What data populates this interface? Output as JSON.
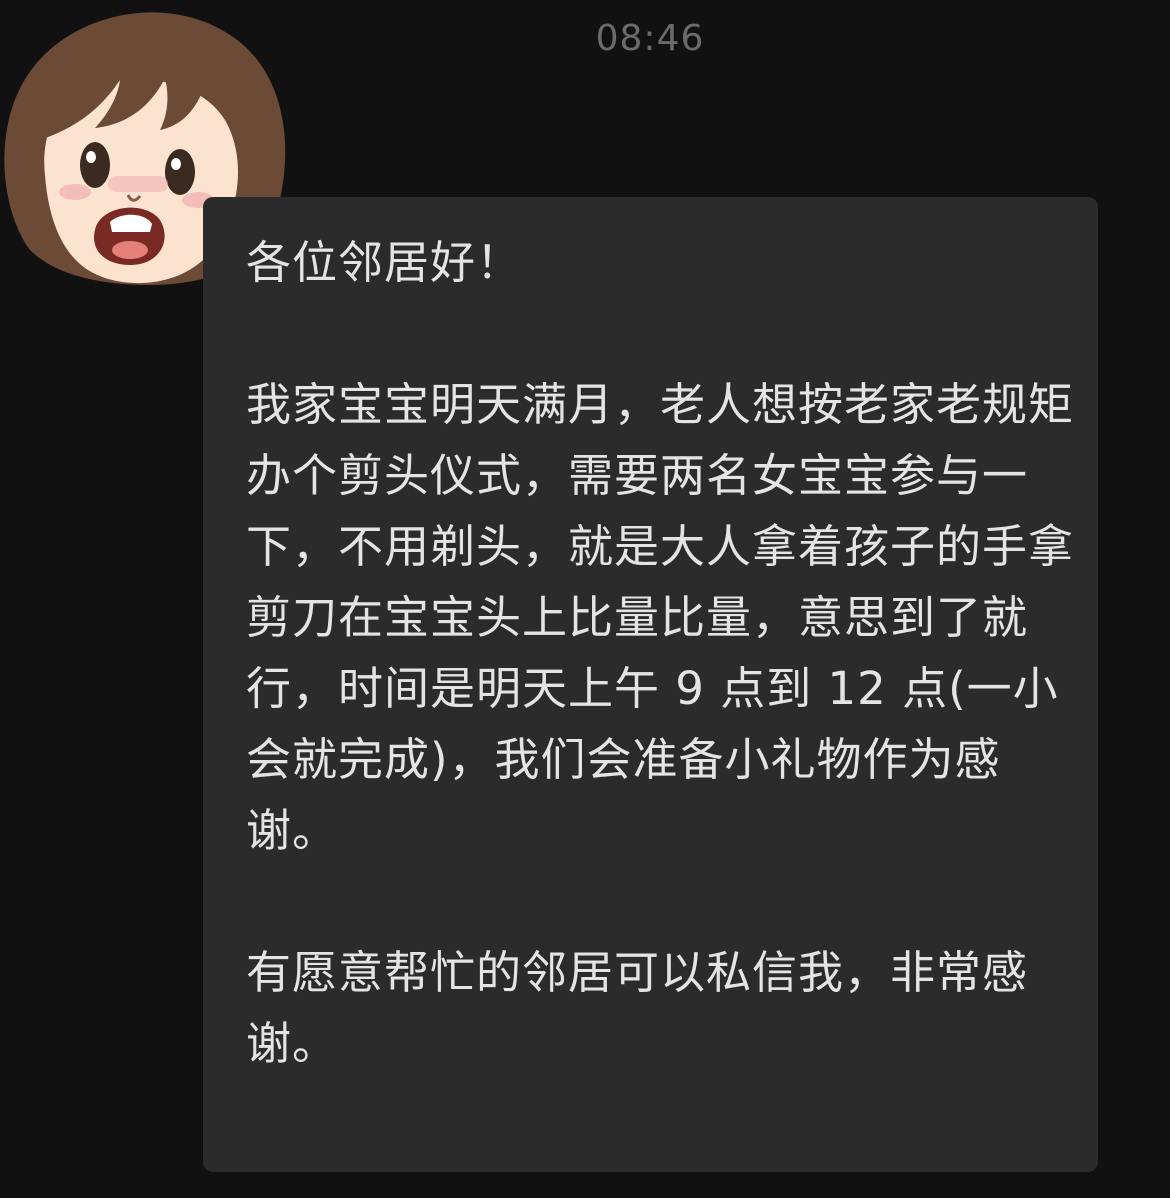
{
  "chat": {
    "timestamp": "08:46",
    "sender_avatar": "cartoon-girl-avatar",
    "message": {
      "greeting": "各位邻居好！",
      "body": "我家宝宝明天满月，老人想按老家老规矩办个剪头仪式，需要两名女宝宝参与一下，不用剃头，就是大人拿着孩子的手拿剪刀在宝宝头上比量比量，意思到了就行，时间是明天上午 9 点到 12 点(一小会就完成)，我们会准备小礼物作为感谢。",
      "closing": "有愿意帮忙的邻居可以私信我，非常感谢。"
    }
  },
  "colors": {
    "background": "#111111",
    "bubble": "#2b2b2b",
    "text": "#e4e4e4",
    "timestamp": "#6b6b6b"
  }
}
